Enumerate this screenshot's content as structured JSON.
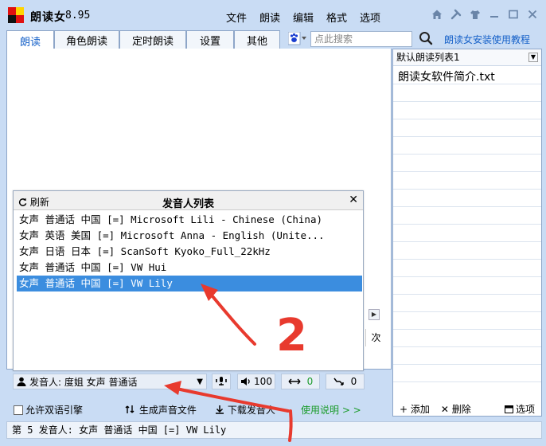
{
  "app": {
    "title": "朗读女",
    "version": "8.95"
  },
  "menu": [
    "文件",
    "朗读",
    "编辑",
    "格式",
    "选项"
  ],
  "tabs": [
    "朗读",
    "角色朗读",
    "定时朗读",
    "设置",
    "其他"
  ],
  "search": {
    "placeholder": "点此搜索"
  },
  "guide_link": "朗读女安装使用教程",
  "playlist": {
    "selected": "默认朗读列表1",
    "items": [
      "朗读女软件简介.txt"
    ],
    "add": "+ 添加",
    "delete": "✕ 删除",
    "options": "选项"
  },
  "next_label": "次",
  "voice_popup": {
    "refresh": "刷新",
    "title": "发音人列表",
    "voices": [
      "女声 普通话 中国 [=] Microsoft Lili - Chinese (China)",
      "女声 英语 美国 [=] Microsoft Anna - English (Unite...",
      "女声 日语 日本 [=] ScanSoft Kyoko_Full_22kHz",
      "女声 普通话 中国 [=] VW Hui",
      "女声 普通话 中国 [=] VW Lily"
    ],
    "selected_index": 4
  },
  "controls": {
    "speaker": "发音人: 度姐 女声 普通话",
    "volume": "100",
    "speed": "0",
    "pitch": "0"
  },
  "bottom": {
    "bilingual": "允许双语引擎",
    "generate": "生成声音文件",
    "download": "下载发音人",
    "usage": "使用说明 > >"
  },
  "status": "第 5 发音人: 女声 普通话 中国 [=] VW Lily",
  "annotations": {
    "label": "2"
  },
  "colors": {
    "accent": "#1560c8",
    "selected": "#3b8ddf",
    "annotation": "#e83a2e",
    "green": "#1a9b2a"
  }
}
